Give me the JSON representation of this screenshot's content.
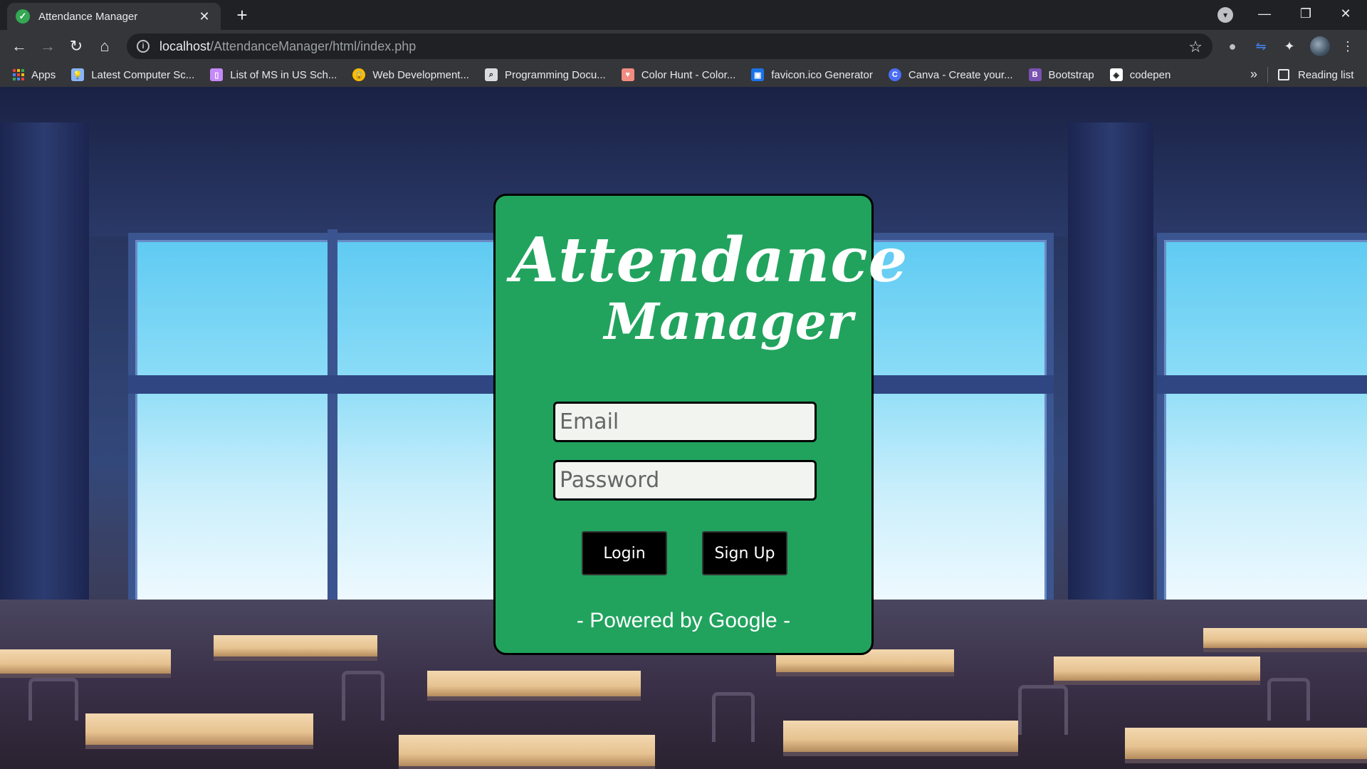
{
  "browser": {
    "tab_title": "Attendance Manager",
    "tab_close": "✕",
    "new_tab": "+",
    "url_host": "localhost",
    "url_path": "/AttendanceManager/html/index.php",
    "window_controls": {
      "minimize": "—",
      "restore": "❐",
      "close": "✕"
    }
  },
  "bookmarks": {
    "items": [
      {
        "label": "Apps",
        "icon": "apps-grid-icon"
      },
      {
        "label": "Latest Computer Sc...",
        "icon": "lightbulb-icon",
        "color": "#8ab4f8"
      },
      {
        "label": "List of MS in US Sch...",
        "icon": "bookmark-icon",
        "color": "#c58af9"
      },
      {
        "label": "Web Development...",
        "icon": "lock-icon",
        "color": "#fbbc04"
      },
      {
        "label": "Programming Docu...",
        "icon": "search-doc-icon",
        "color": "#9aa0a6"
      },
      {
        "label": "Color Hunt - Color...",
        "icon": "palette-icon",
        "color": "#f28b82"
      },
      {
        "label": "favicon.ico Generator",
        "icon": "favicon-icon",
        "color": "#1a73e8"
      },
      {
        "label": "Canva - Create your...",
        "icon": "canva-icon",
        "color": "#00c4cc"
      },
      {
        "label": "Bootstrap",
        "icon": "bootstrap-icon",
        "color": "#7952b3"
      },
      {
        "label": "codepen",
        "icon": "codepen-icon",
        "color": "#ffffff"
      }
    ],
    "more": "»",
    "reading_list": "Reading list"
  },
  "login": {
    "title_line1": "Attendance",
    "title_line2": "Manager",
    "email_placeholder": "Email",
    "password_placeholder": "Password",
    "login_label": "Login",
    "signup_label": "Sign Up",
    "powered_by": "- Powered by Google -"
  },
  "colors": {
    "card_bg": "#21a35e",
    "button_bg": "#000000",
    "input_bg": "#f1f4ef"
  }
}
